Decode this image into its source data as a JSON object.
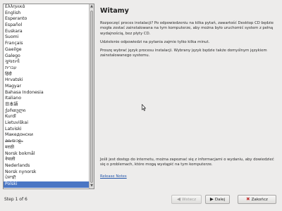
{
  "languages": [
    "Ελληνικά",
    "English",
    "Esperanto",
    "Español",
    "Euskara",
    "Suomi",
    "Français",
    "Gaeilge",
    "Galego",
    "ગુજરાતી",
    "עברית",
    "हिंदी",
    "Hrvatski",
    "Magyar",
    "Bahasa Indonesia",
    "Italiano",
    "日本語",
    "ქართული",
    "Kurdî",
    "Lietuviškai",
    "Latviski",
    "Македонски",
    "മലയാളം",
    "मराठी",
    "Norsk bokmål",
    "नेपाली",
    "Nederlands",
    "Norsk nynorsk",
    "ਪੰਜਾਬੀ",
    "Polski"
  ],
  "selected_language": "Polski",
  "title": "Witamy",
  "paragraphs": [
    "Rozpoczęć proces instalacji? Po odpowiedzeniu na kilka pytań, zawartość Desktop CD będzie mogła zostać zainstalowana na tym komputerze, aby można było uruchomić system z pełną wydajnością, bez płyty CD.",
    "Udzielenie odpowiedzi na pytania zajmie tylko kilka minut.",
    "Proszę wybrać język procesu instalacji. Wybrany język będzie także domyślnym językiem zainstalowanego systemu."
  ],
  "internet_note": "Jeśli jest dostęp do internetu, można zapoznać się z informacjami o wydaniu, aby dowiedzieć się o problemach, które mogą wystąpić na tym komputerze.",
  "release_notes_label": "Release Notes",
  "step_label": "Step 1 of 6",
  "buttons": {
    "back": "Wstecz",
    "next": "Dalej",
    "quit": "Zakończ"
  },
  "colors": {
    "selection": "#4a76c4",
    "link": "#2255aa",
    "background": "#edeceb"
  }
}
